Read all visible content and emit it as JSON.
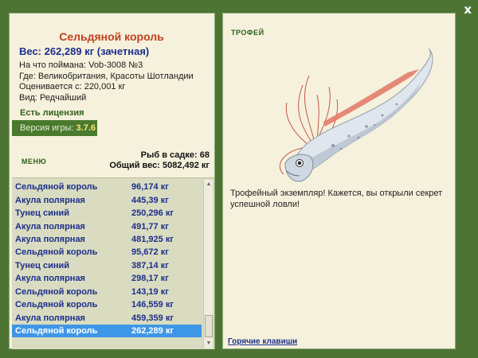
{
  "window": {
    "close_label": "x"
  },
  "fish_info": {
    "title": "Сельдяной король",
    "weight": "Вес: 262,289 кг (зачетная)",
    "bait": "На что поймана: Vob-3008 №3",
    "location": "Где: Великобритания, Красоты Шотландии",
    "valued_from": "Оценивается с: 220,001 кг",
    "species_type": "Вид: Редчайший"
  },
  "license": "Есть лицензия",
  "version": {
    "label": "Версия игры:",
    "number": "3.7.6"
  },
  "menu_label": "МЕНЮ",
  "stats": {
    "fish_in_keepnet": "Рыб в садке: 68",
    "total_weight": "Общий вес: 5082,492 кг"
  },
  "catch_list": [
    {
      "name": "Сельдяной король",
      "weight": "96,174 кг"
    },
    {
      "name": "Акула полярная",
      "weight": "445,39 кг"
    },
    {
      "name": "Тунец синий",
      "weight": "250,296 кг"
    },
    {
      "name": "Акула полярная",
      "weight": "491,77 кг"
    },
    {
      "name": "Акула полярная",
      "weight": "481,925 кг"
    },
    {
      "name": "Сельдяной король",
      "weight": "95,672 кг"
    },
    {
      "name": "Тунец синий",
      "weight": "387,14 кг"
    },
    {
      "name": "Акула полярная",
      "weight": "298,17 кг"
    },
    {
      "name": "Сельдяной король",
      "weight": "143,19 кг"
    },
    {
      "name": "Сельдяной король",
      "weight": "146,559 кг"
    },
    {
      "name": "Акула полярная",
      "weight": "459,359 кг"
    },
    {
      "name": "Сельдяной король",
      "weight": "262,289 кг"
    }
  ],
  "selected_index": 11,
  "trophy": {
    "label": "ТРОФЕЙ",
    "description": "Трофейный экземпляр! Кажется, вы открыли секрет успешной ловли!"
  },
  "hotkeys_label": "Горячие клавиши",
  "colors": {
    "background": "#4e7434",
    "panel": "#f6f1dc",
    "accent_green": "#2e5e1a",
    "title_red": "#c0401f",
    "text_blue": "#1c2e8c",
    "selection": "#3d96e6"
  }
}
